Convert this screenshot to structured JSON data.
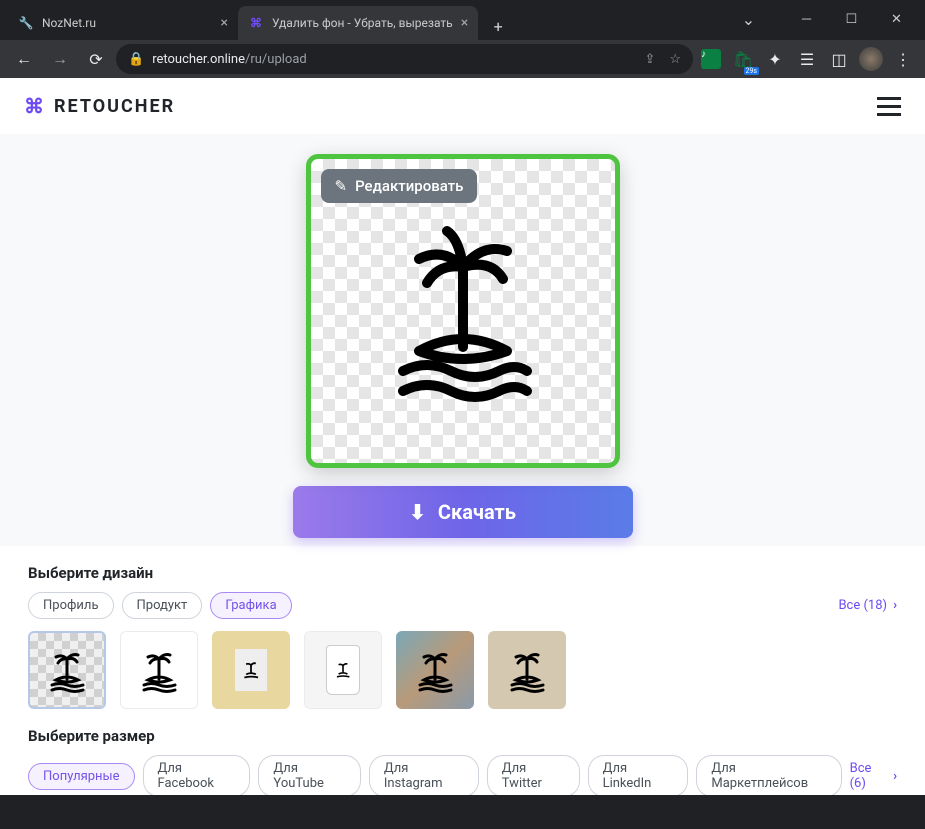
{
  "window": {
    "tabs": [
      {
        "title": "NozNet.ru",
        "active": false
      },
      {
        "title": "Удалить фон - Убрать, вырезать",
        "active": true
      }
    ]
  },
  "toolbar": {
    "url_domain": "retoucher.online",
    "url_path": "/ru/upload",
    "ext_badge": "29s"
  },
  "header": {
    "logo_text": "RETOUCHER"
  },
  "preview": {
    "edit_label": "Редактировать"
  },
  "download": {
    "label": "Скачать"
  },
  "design": {
    "title": "Выберите дизайн",
    "chips": [
      "Профиль",
      "Продукт",
      "Графика"
    ],
    "all_label": "Все (18)"
  },
  "size": {
    "title": "Выберите размер",
    "chips": [
      "Популярные",
      "Для Facebook",
      "Для YouTube",
      "Для Instagram",
      "Для Twitter",
      "Для LinkedIn",
      "Для Маркетплейсов"
    ],
    "all_label": "Все (6)"
  }
}
